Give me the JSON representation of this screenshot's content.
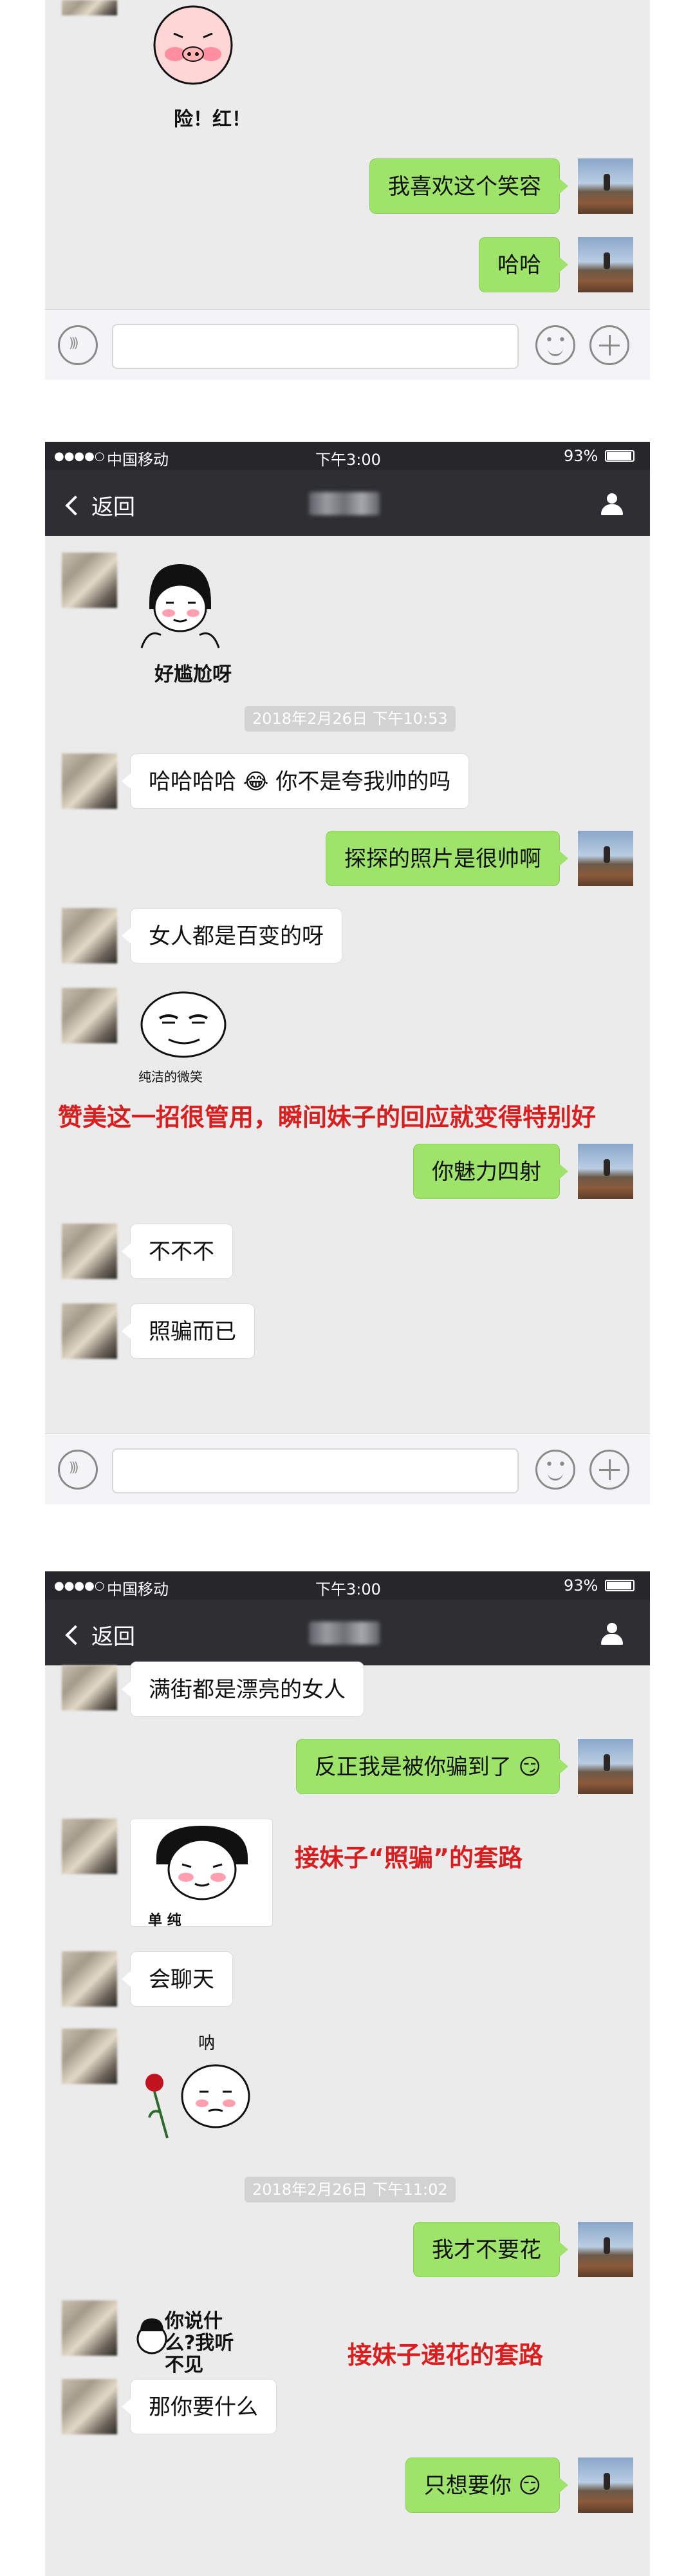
{
  "colors": {
    "bubble_right": "#9ee36a",
    "bubble_left": "#ffffff",
    "chat_bg": "#ebebeb",
    "nav_bg": "#2f2f33",
    "annotation_red": "#d81e1e"
  },
  "panel1": {
    "sticker_caption": "险！红！",
    "messages": [
      {
        "side": "right",
        "text": "我喜欢这个笑容"
      },
      {
        "side": "right",
        "text": "哈哈"
      }
    ]
  },
  "panel2": {
    "status": {
      "signal": "●●●●○",
      "carrier": "中国移动",
      "time": "下午3:00",
      "battery": "93%"
    },
    "nav": {
      "back_label": "返回"
    },
    "sticker1_caption": "好尴尬呀",
    "timestamp": "2018年2月26日 下午10:53",
    "messages": [
      {
        "side": "left",
        "text": "哈哈哈哈 😂 你不是夸我帅的吗"
      },
      {
        "side": "right",
        "text": "探探的照片是很帅啊"
      },
      {
        "side": "left",
        "text": "女人都是百变的呀"
      }
    ],
    "sticker2_caption": "纯洁的微笑",
    "annotation": "赞美这一招很管用，瞬间妹子的回应就变得特别好",
    "messages2": [
      {
        "side": "right",
        "text": "你魅力四射"
      },
      {
        "side": "left",
        "text": "不不不"
      },
      {
        "side": "left",
        "text": "照骗而已"
      }
    ]
  },
  "panel3": {
    "status": {
      "signal": "●●●●○",
      "carrier": "中国移动",
      "time": "下午3:00",
      "battery": "93%"
    },
    "nav": {
      "back_label": "返回"
    },
    "messages": [
      {
        "side": "left",
        "text": "满街都是漂亮的女人"
      },
      {
        "side": "right",
        "text": "反正我是被你骗到了 😏"
      }
    ],
    "sticker1_caption": "单 纯",
    "annotation1": "接妹子“照骗”的套路",
    "message_chat": {
      "side": "left",
      "text": "会聊天"
    },
    "sticker2_caption": "呐",
    "timestamp": "2018年2月26日 下午11:02",
    "message_flower": {
      "side": "right",
      "text": "我才不要花"
    },
    "sticker3_caption": "你说什么?我听不见",
    "annotation2": "接妹子递花的套路",
    "message_what": {
      "side": "left",
      "text": "那你要什么"
    },
    "message_you": {
      "side": "right",
      "text": "只想要你 😏"
    }
  }
}
